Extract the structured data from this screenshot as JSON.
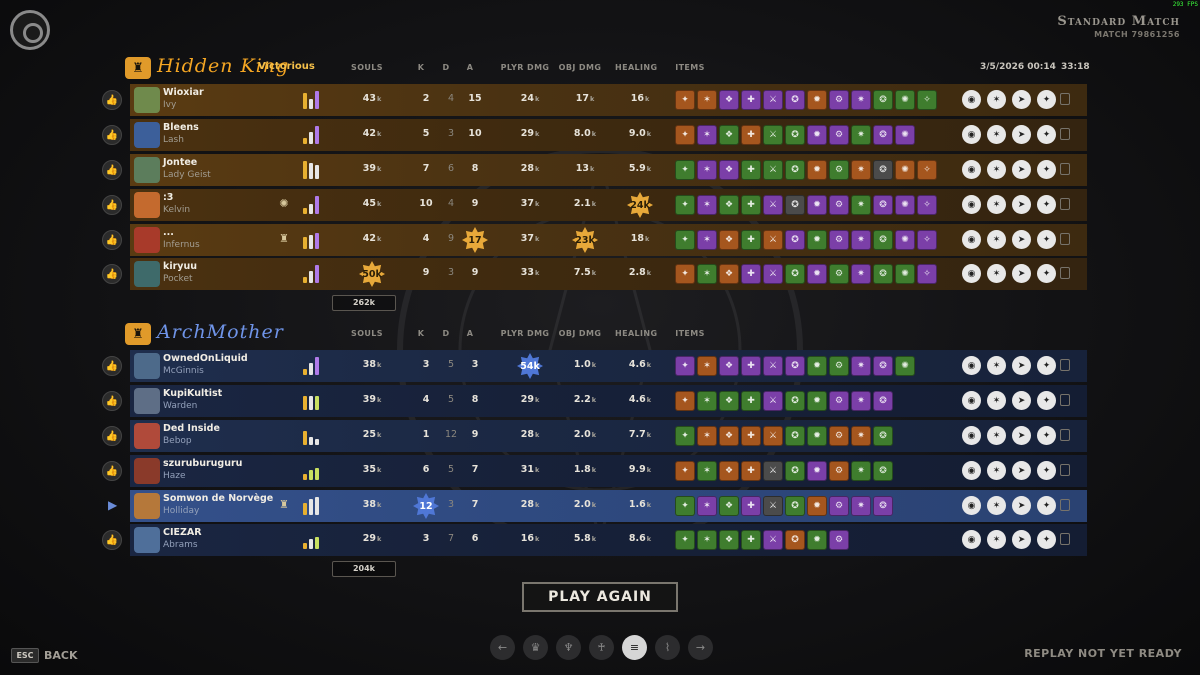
{
  "fps": "293 FPS",
  "match": {
    "type": "Standard Match",
    "id": "MATCH 79861256"
  },
  "date": "3/5/2026 00:14",
  "duration": "33:18",
  "columns": {
    "souls": "SOULS",
    "k": "K",
    "d": "D",
    "a": "A",
    "plyr_dmg": "PLYR DMG",
    "obj_dmg": "OBJ DMG",
    "healing": "HEALING",
    "items": "ITEMS"
  },
  "teams": [
    {
      "name": "Hidden King",
      "result": "Victorious",
      "color": "#f5a623",
      "total_souls": "262k",
      "players": [
        {
          "name": "Wioxiar",
          "hero": "Ivy",
          "souls": "43",
          "k": "2",
          "d": "4",
          "a": "15",
          "plyr_dmg": "24",
          "obj_dmg": "17",
          "healing": "16",
          "hero_color": "#6f8a4c"
        },
        {
          "name": "Bleens",
          "hero": "Lash",
          "souls": "42",
          "k": "5",
          "d": "3",
          "a": "10",
          "plyr_dmg": "29",
          "obj_dmg": "8.0",
          "healing": "9.0",
          "hero_color": "#3c5f9a"
        },
        {
          "name": "Jontee",
          "hero": "Lady Geist",
          "souls": "39",
          "k": "7",
          "d": "6",
          "a": "8",
          "plyr_dmg": "28",
          "obj_dmg": "13",
          "healing": "5.9",
          "hero_color": "#5c7d5c"
        },
        {
          "name": ":3",
          "hero": "Kelvin",
          "souls": "45",
          "k": "10",
          "d": "4",
          "a": "9",
          "plyr_dmg": "37",
          "obj_dmg": "2.1",
          "healing": "24",
          "hero_color": "#c46a2e"
        },
        {
          "name": "...",
          "hero": "Infernus",
          "souls": "42",
          "k": "4",
          "d": "9",
          "a": "17",
          "plyr_dmg": "37",
          "obj_dmg": "23",
          "healing": "18",
          "hero_color": "#a83a2a"
        },
        {
          "name": "kiryuu",
          "hero": "Pocket",
          "souls": "50",
          "k": "9",
          "d": "3",
          "a": "9",
          "plyr_dmg": "33",
          "obj_dmg": "7.5",
          "healing": "2.8",
          "hero_color": "#3e6a6a"
        }
      ]
    },
    {
      "name": "ArchMother",
      "color": "#6f94e8",
      "total_souls": "204k",
      "players": [
        {
          "name": "OwnedOnLiquid",
          "hero": "McGinnis",
          "souls": "38",
          "k": "3",
          "d": "5",
          "a": "3",
          "plyr_dmg": "54",
          "obj_dmg": "1.0",
          "healing": "4.6",
          "hero_color": "#4d6a8a"
        },
        {
          "name": "KupiKultist",
          "hero": "Warden",
          "souls": "39",
          "k": "4",
          "d": "5",
          "a": "8",
          "plyr_dmg": "29",
          "obj_dmg": "2.2",
          "healing": "4.6",
          "hero_color": "#5e6e86"
        },
        {
          "name": "Ded Inside",
          "hero": "Bebop",
          "souls": "25",
          "k": "1",
          "d": "12",
          "a": "9",
          "plyr_dmg": "28",
          "obj_dmg": "2.0",
          "healing": "7.7",
          "hero_color": "#b04a3a"
        },
        {
          "name": "szuruburuguru",
          "hero": "Haze",
          "souls": "35",
          "k": "6",
          "d": "5",
          "a": "7",
          "plyr_dmg": "31",
          "obj_dmg": "1.8",
          "healing": "9.9",
          "hero_color": "#8a3a2a"
        },
        {
          "name": "Somwon de Norvège",
          "hero": "Holliday",
          "souls": "38",
          "k": "12",
          "d": "3",
          "a": "7",
          "plyr_dmg": "28",
          "obj_dmg": "2.0",
          "healing": "1.6",
          "hero_color": "#b5783a"
        },
        {
          "name": "CIEZAR",
          "hero": "Abrams",
          "souls": "29",
          "k": "3",
          "d": "7",
          "a": "6",
          "plyr_dmg": "16",
          "obj_dmg": "5.8",
          "healing": "8.6",
          "hero_color": "#4f6f9a"
        }
      ]
    }
  ],
  "play_again": "PLAY AGAIN",
  "esc_key": "ESC",
  "back": "BACK",
  "replay_status": "REPLAY NOT YET READY",
  "k_suffix": "k"
}
